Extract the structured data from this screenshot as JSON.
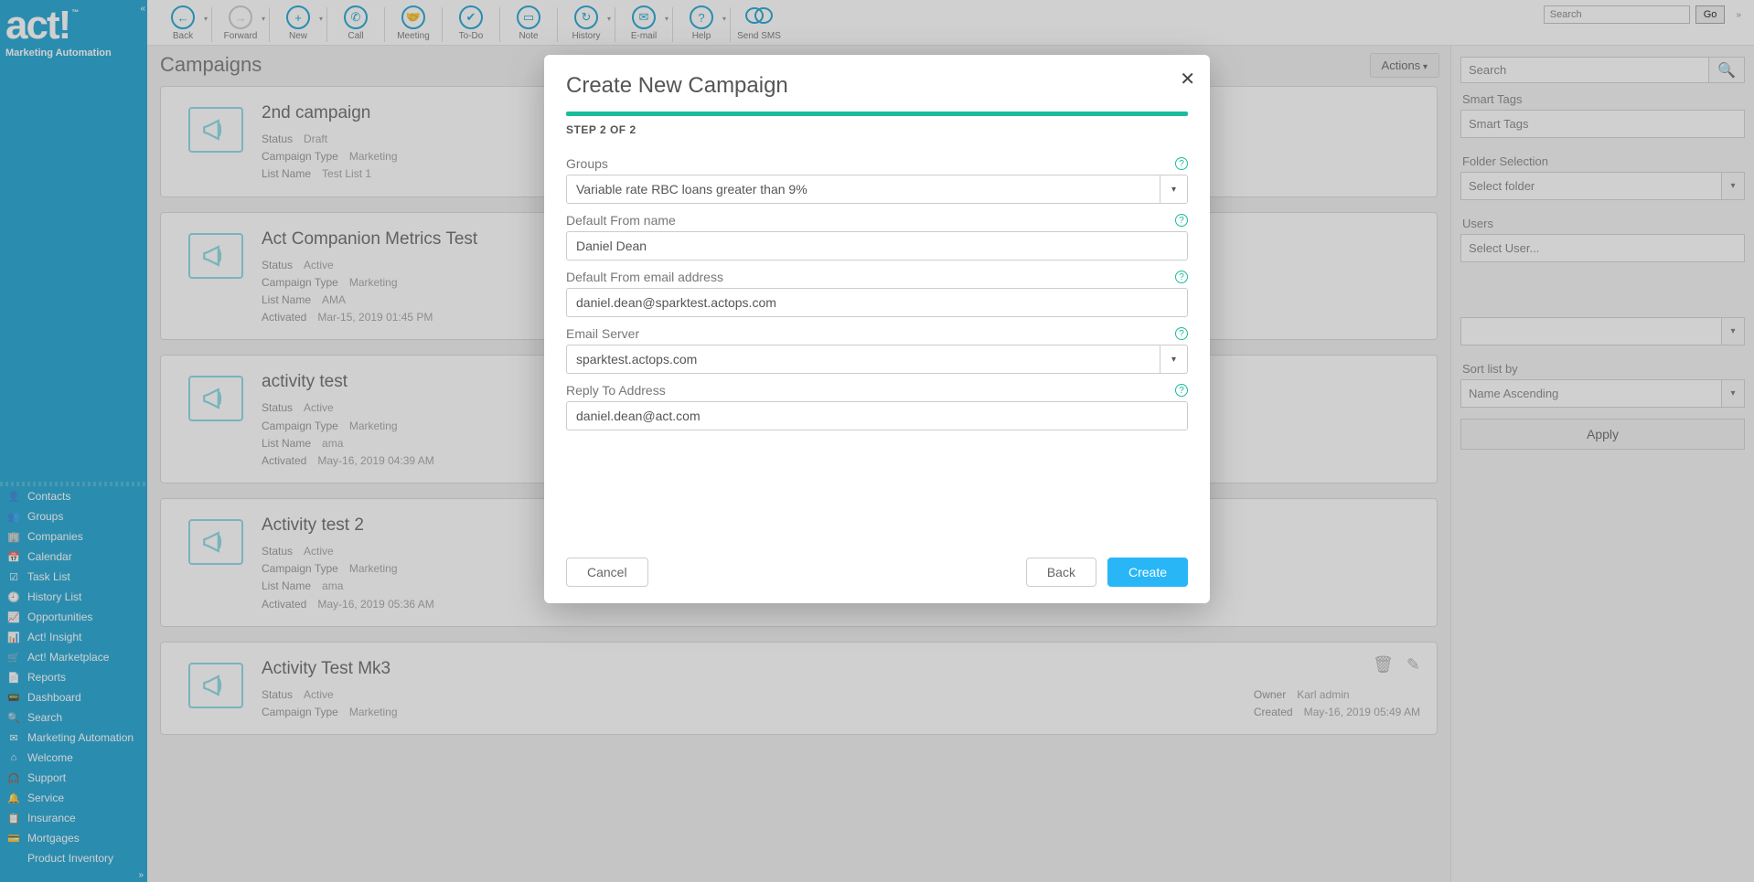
{
  "brand": {
    "name": "act!",
    "tm": "™",
    "sub": "Marketing Automation"
  },
  "toolbar": [
    {
      "id": "back",
      "label": "Back",
      "glyph": "←",
      "faded": false,
      "caret": true
    },
    {
      "id": "forward",
      "label": "Forward",
      "glyph": "→",
      "faded": true,
      "caret": true
    },
    {
      "id": "new",
      "label": "New",
      "glyph": "+",
      "faded": false,
      "caret": true
    },
    {
      "id": "call",
      "label": "Call",
      "glyph": "✆",
      "faded": false,
      "caret": false
    },
    {
      "id": "meeting",
      "label": "Meeting",
      "glyph": "🤝",
      "faded": false,
      "caret": false
    },
    {
      "id": "todo",
      "label": "To-Do",
      "glyph": "✔",
      "faded": false,
      "caret": false
    },
    {
      "id": "note",
      "label": "Note",
      "glyph": "▭",
      "faded": false,
      "caret": false
    },
    {
      "id": "history",
      "label": "History",
      "glyph": "↻",
      "faded": false,
      "caret": true
    },
    {
      "id": "email",
      "label": "E-mail",
      "glyph": "✉",
      "faded": false,
      "caret": true
    },
    {
      "id": "help",
      "label": "Help",
      "glyph": "?",
      "faded": false,
      "caret": true
    },
    {
      "id": "sms",
      "label": "Send SMS",
      "glyph": "💬",
      "faded": false,
      "caret": false,
      "double": true
    }
  ],
  "top_search": {
    "placeholder": "Search",
    "go": "Go"
  },
  "sidebar_nav": [
    {
      "id": "contacts",
      "label": "Contacts",
      "glyph": "👤"
    },
    {
      "id": "groups",
      "label": "Groups",
      "glyph": "👥"
    },
    {
      "id": "companies",
      "label": "Companies",
      "glyph": "🏢"
    },
    {
      "id": "calendar",
      "label": "Calendar",
      "glyph": "📅"
    },
    {
      "id": "tasklist",
      "label": "Task List",
      "glyph": "☑"
    },
    {
      "id": "historylist",
      "label": "History List",
      "glyph": "🕘"
    },
    {
      "id": "opps",
      "label": "Opportunities",
      "glyph": "📈"
    },
    {
      "id": "insight",
      "label": "Act! Insight",
      "glyph": "📊"
    },
    {
      "id": "marketplace",
      "label": "Act! Marketplace",
      "glyph": "🛒"
    },
    {
      "id": "reports",
      "label": "Reports",
      "glyph": "📄"
    },
    {
      "id": "dashboard",
      "label": "Dashboard",
      "glyph": "📟"
    },
    {
      "id": "search",
      "label": "Search",
      "glyph": "🔍"
    },
    {
      "id": "ma",
      "label": "Marketing Automation",
      "glyph": "✉"
    },
    {
      "id": "welcome",
      "label": "Welcome",
      "glyph": "⌂"
    },
    {
      "id": "support",
      "label": "Support",
      "glyph": "🎧"
    },
    {
      "id": "service",
      "label": "Service",
      "glyph": "🔔"
    },
    {
      "id": "insurance",
      "label": "Insurance",
      "glyph": "📋"
    },
    {
      "id": "mortgages",
      "label": "Mortgages",
      "glyph": "💳"
    },
    {
      "id": "inventory",
      "label": "Product Inventory",
      "glyph": ""
    }
  ],
  "page": {
    "title": "Campaigns",
    "actions": "Actions"
  },
  "labels": {
    "status": "Status",
    "campaign_type": "Campaign Type",
    "list_name": "List Name",
    "activated": "Activated",
    "owner": "Owner",
    "created": "Created"
  },
  "campaigns": [
    {
      "title": "2nd campaign",
      "status": "Draft",
      "ctype": "Marketing",
      "list": "Test List 1",
      "activated": ""
    },
    {
      "title": "Act Companion Metrics Test",
      "status": "Active",
      "ctype": "Marketing",
      "list": "AMA",
      "activated": "Mar-15, 2019 01:45 PM"
    },
    {
      "title": "activity test",
      "status": "Active",
      "ctype": "Marketing",
      "list": "ama",
      "activated": "May-16, 2019 04:39 AM"
    },
    {
      "title": "Activity test 2",
      "status": "Active",
      "ctype": "Marketing",
      "list": "ama",
      "activated": "May-16, 2019 05:36 AM"
    },
    {
      "title": "Activity Test Mk3",
      "status": "Active",
      "ctype": "Marketing",
      "list": "",
      "activated": "",
      "owner": "Karl admin",
      "created": "May-16, 2019 05:49 AM"
    }
  ],
  "right_panel": {
    "search_ph": "Search",
    "smart_tags_label": "Smart Tags",
    "smart_tags_ph": "Smart Tags",
    "folder_label": "Folder Selection",
    "folder_ph": "Select folder",
    "users_label": "Users",
    "users_ph": "Select User...",
    "blank_sel": "",
    "sort_label": "Sort list by",
    "sort_val": "Name Ascending",
    "apply": "Apply"
  },
  "modal": {
    "title": "Create New Campaign",
    "step": "STEP 2 OF 2",
    "fields": {
      "groups_label": "Groups",
      "groups_value": "Variable rate RBC loans greater than 9%",
      "from_name_label": "Default From name",
      "from_name_value": "Daniel Dean",
      "from_email_label": "Default From email address",
      "from_email_value": "daniel.dean@sparktest.actops.com",
      "server_label": "Email Server",
      "server_value": "sparktest.actops.com",
      "reply_label": "Reply To Address",
      "reply_value": "daniel.dean@act.com"
    },
    "buttons": {
      "cancel": "Cancel",
      "back": "Back",
      "create": "Create"
    }
  },
  "colors": {
    "brand": "#0099cc",
    "accent": "#1abc9c",
    "primary_btn": "#29b6f6"
  }
}
